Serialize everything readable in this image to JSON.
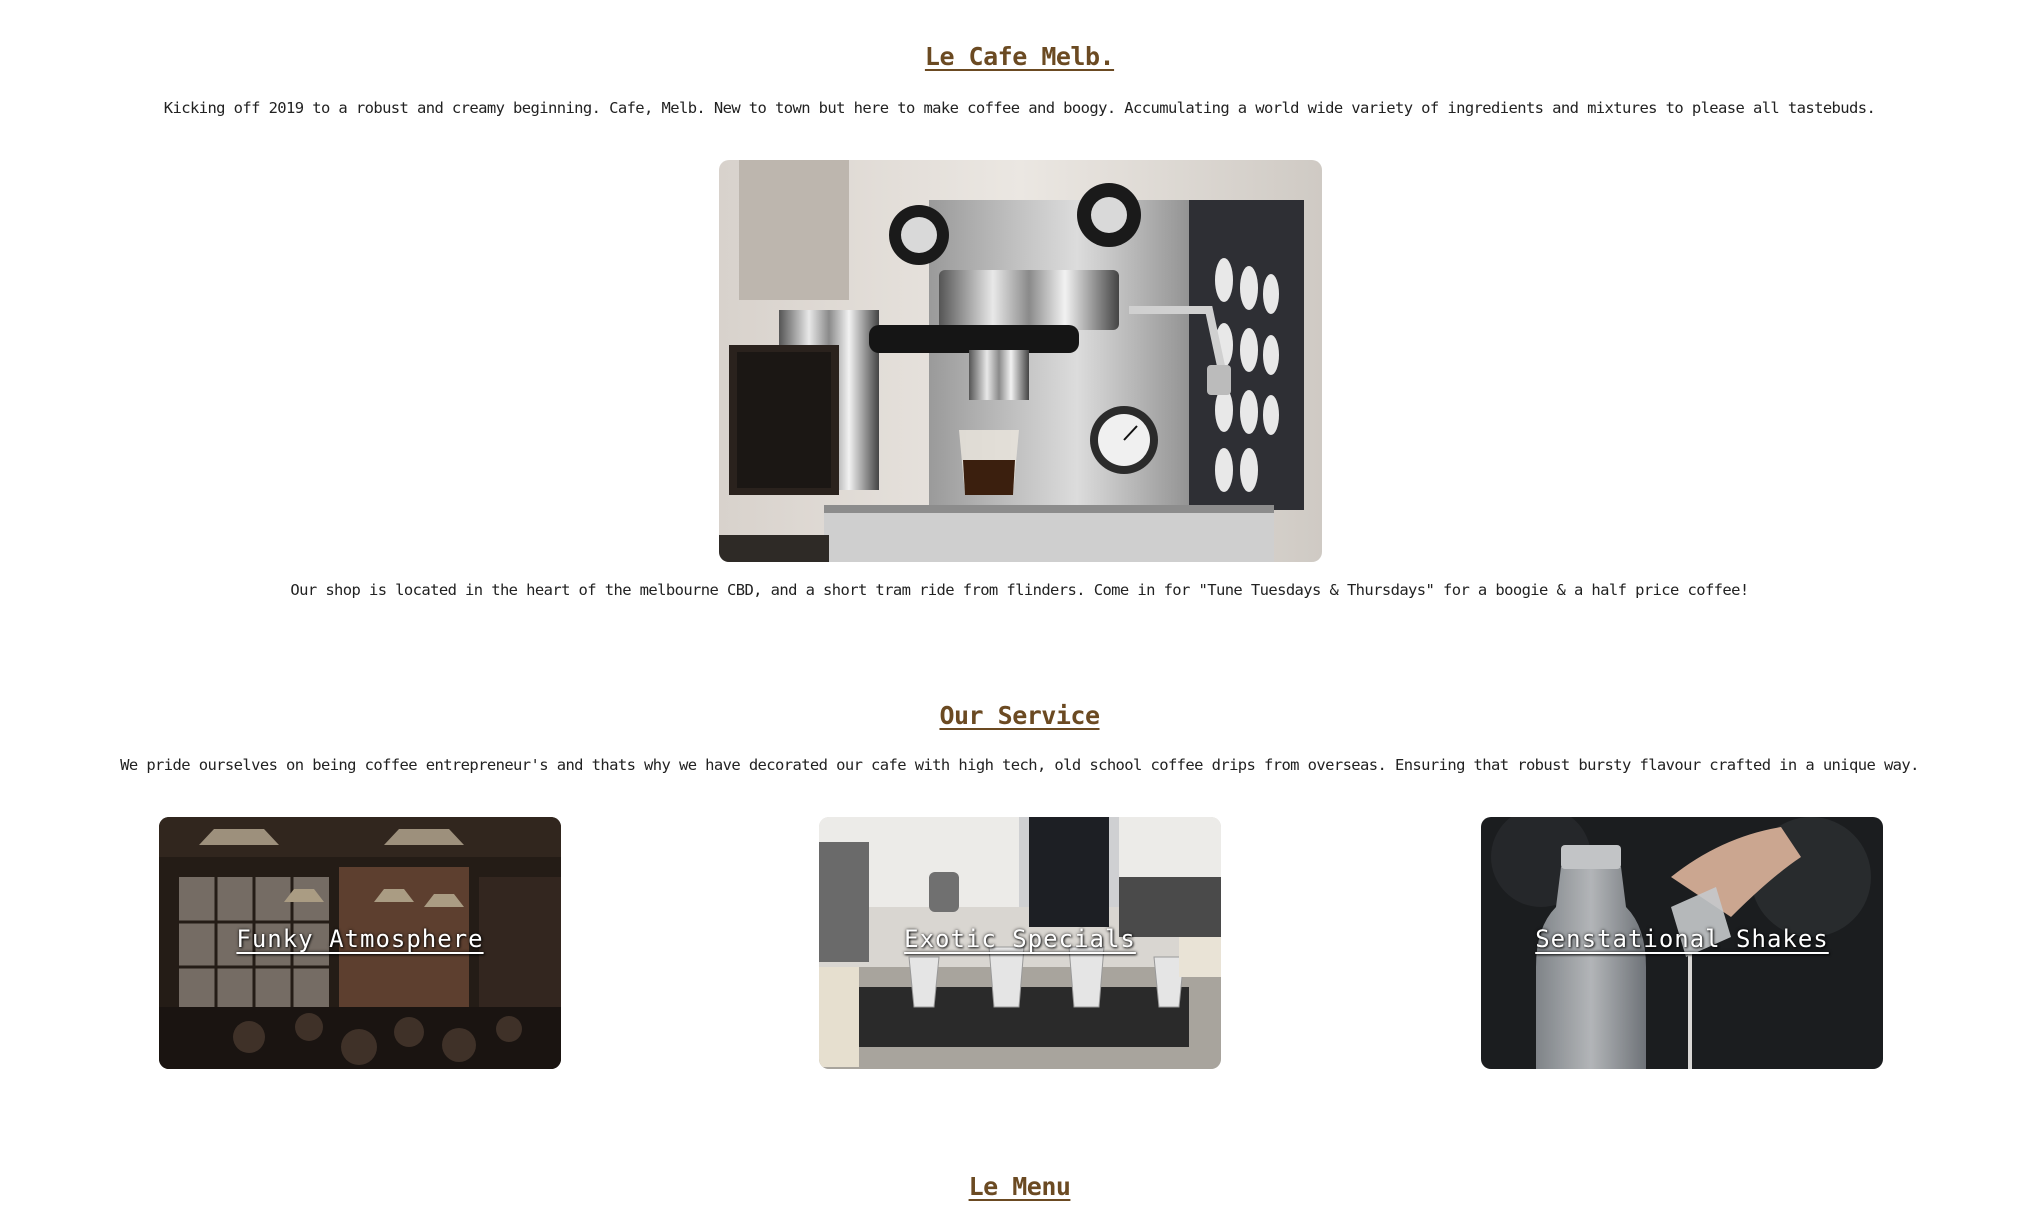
{
  "intro": {
    "title": "Le Cafe Melb.",
    "description": "Kicking off 2019 to a robust and creamy beginning. Cafe, Melb. New to town but here to make coffee and boogy. Accumulating a world wide variety of ingredients and mixtures to please all tastebuds.",
    "location_text": "Our shop is located in the heart of the melbourne CBD, and a short tram ride from flinders. Come in for \"Tune Tuesdays & Thursdays\" for a boogie & a half price coffee!"
  },
  "service": {
    "title": "Our Service",
    "description": "We pride ourselves on being coffee entrepreneur's and thats why we have decorated our cafe with high tech, old school coffee drips from overseas. Ensuring that robust bursty flavour crafted in a unique way.",
    "cards": [
      {
        "label": "Funky Atmosphere"
      },
      {
        "label": "Exotic Specials"
      },
      {
        "label": "Senstational Shakes"
      }
    ]
  },
  "menu": {
    "title": "Le Menu"
  },
  "colors": {
    "heading": "#6b4a22",
    "text": "#222222",
    "background": "#ffffff"
  }
}
